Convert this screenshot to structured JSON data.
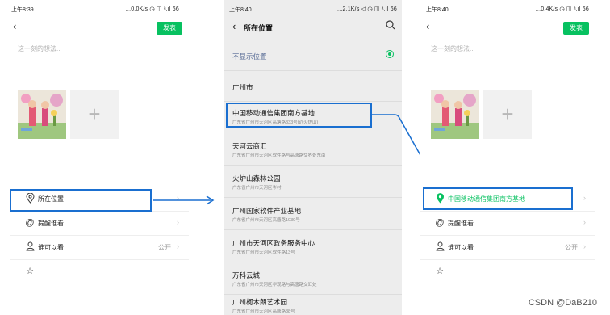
{
  "screen1": {
    "status": {
      "time": "上午8:39",
      "info": "...0.0K/s ◷ ◫ ᵃ.ıl 66"
    },
    "back_icon": "‹",
    "publish_label": "发表",
    "placeholder": "这一刻的想法...",
    "options": [
      {
        "label": "所在位置",
        "value": "",
        "icon": "location-icon"
      },
      {
        "label": "提醒谁看",
        "value": "",
        "icon": "at-icon"
      },
      {
        "label": "谁可以看",
        "value": "公开",
        "icon": "user-icon"
      },
      {
        "label": "",
        "value": "",
        "icon": "star-icon"
      }
    ]
  },
  "screen2": {
    "status": {
      "time": "上午8:40",
      "info": "...2.1K/s ◁ ◷ ◫ ᵃ.ıl 66"
    },
    "title": "所在位置",
    "locations": [
      {
        "name": "不显示位置",
        "addr": "",
        "selected": true
      },
      {
        "name": "广州市",
        "addr": ""
      },
      {
        "name": "中国移动通信集团南方基地",
        "addr": "广东省广州市天河区高塘路333号(近火炉山)"
      },
      {
        "name": "天河云商汇",
        "addr": "广东省广州市天河区软件路与高唐路交界处东南"
      },
      {
        "name": "火炉山森林公园",
        "addr": "广东省广州市天河区岑村"
      },
      {
        "name": "广州国家软件产业基地",
        "addr": "广东省广州市天河区高唐路1039号"
      },
      {
        "name": "广州市天河区政务服务中心",
        "addr": "广东省广州市天河区软件路13号"
      },
      {
        "name": "万科云城",
        "addr": "广东省广州市天河区华观路与高唐路交汇处"
      },
      {
        "name": "广州柯木朗艺术园",
        "addr": "广东省广州市天河区高唐路88号"
      }
    ]
  },
  "screen3": {
    "status": {
      "time": "上午8:40",
      "info": "...0.4K/s ◷ ◫ ᵃ.ıl 66"
    },
    "back_icon": "‹",
    "publish_label": "发表",
    "placeholder": "这一刻的想法...",
    "options": [
      {
        "label": "中国移动通信集团南方基地",
        "value": "",
        "icon": "location-pin-icon"
      },
      {
        "label": "提醒谁看",
        "value": "",
        "icon": "at-icon"
      },
      {
        "label": "谁可以看",
        "value": "公开",
        "icon": "user-icon"
      },
      {
        "label": "",
        "value": "",
        "icon": "star-icon"
      }
    ]
  },
  "watermark": "CSDN @DaB210",
  "colors": {
    "accent": "#07c160",
    "highlight": "#1a6fd0"
  }
}
